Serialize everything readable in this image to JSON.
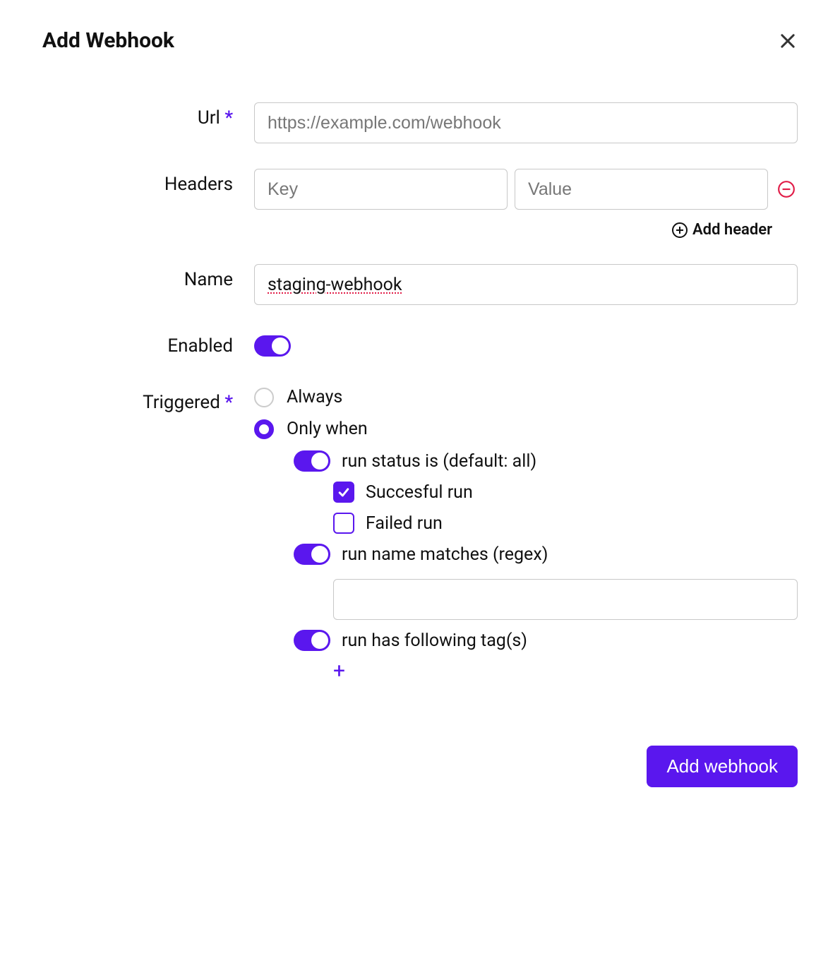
{
  "title": "Add Webhook",
  "fields": {
    "url": {
      "label": "Url",
      "required": true,
      "placeholder": "https://example.com/webhook",
      "value": ""
    },
    "headers": {
      "label": "Headers",
      "key_placeholder": "Key",
      "value_placeholder": "Value",
      "rows": [
        {
          "key": "",
          "value": ""
        }
      ],
      "add_label": "Add header"
    },
    "name": {
      "label": "Name",
      "value": "staging-webhook"
    },
    "enabled": {
      "label": "Enabled",
      "value": true
    },
    "triggered": {
      "label": "Triggered",
      "required": true,
      "options": {
        "always": "Always",
        "only_when": "Only when"
      },
      "selected": "only_when",
      "conditions": {
        "run_status": {
          "enabled": true,
          "label": "run status is (default: all)",
          "successful": {
            "label": "Succesful run",
            "checked": true
          },
          "failed": {
            "label": "Failed run",
            "checked": false
          }
        },
        "run_name": {
          "enabled": true,
          "label": "run name matches (regex)",
          "value": ""
        },
        "run_tags": {
          "enabled": true,
          "label": "run has following tag(s)",
          "tags": []
        }
      }
    }
  },
  "submit_label": "Add webhook"
}
